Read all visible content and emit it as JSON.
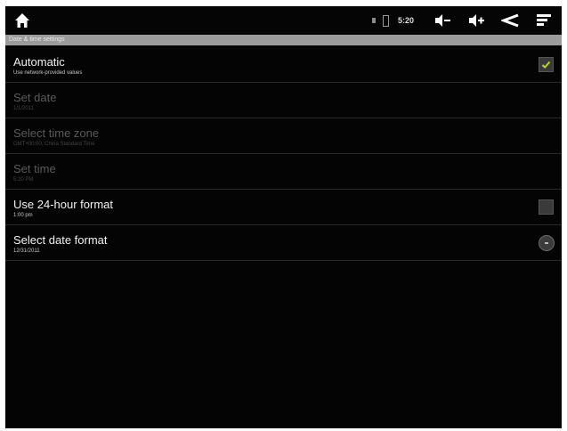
{
  "status_bar": {
    "time": "5:20",
    "icons": [
      "home-icon",
      "volume-down-icon",
      "volume-up-icon",
      "back-icon",
      "menu-icon"
    ]
  },
  "section": {
    "title": "Date & time settings"
  },
  "rows": [
    {
      "title": "Automatic",
      "summary": "Use network-provided values",
      "enabled": true,
      "control": "checkbox",
      "checked": true
    },
    {
      "title": "Set date",
      "summary": "1/1/2011",
      "enabled": false
    },
    {
      "title": "Select time zone",
      "summary": "GMT+00:00, China Standard Time",
      "enabled": false
    },
    {
      "title": "Set time",
      "summary": "5:20 PM",
      "enabled": false
    },
    {
      "title": "Use 24-hour format",
      "summary": "1:00 pm",
      "enabled": true,
      "control": "checkbox",
      "checked": false
    },
    {
      "title": "Select date format",
      "summary": "12/31/2011",
      "enabled": true,
      "control": "dropdown"
    }
  ],
  "colors": {
    "background": "#040404",
    "check_accent": "#b8d432",
    "section_header": "#9b9b9b"
  }
}
